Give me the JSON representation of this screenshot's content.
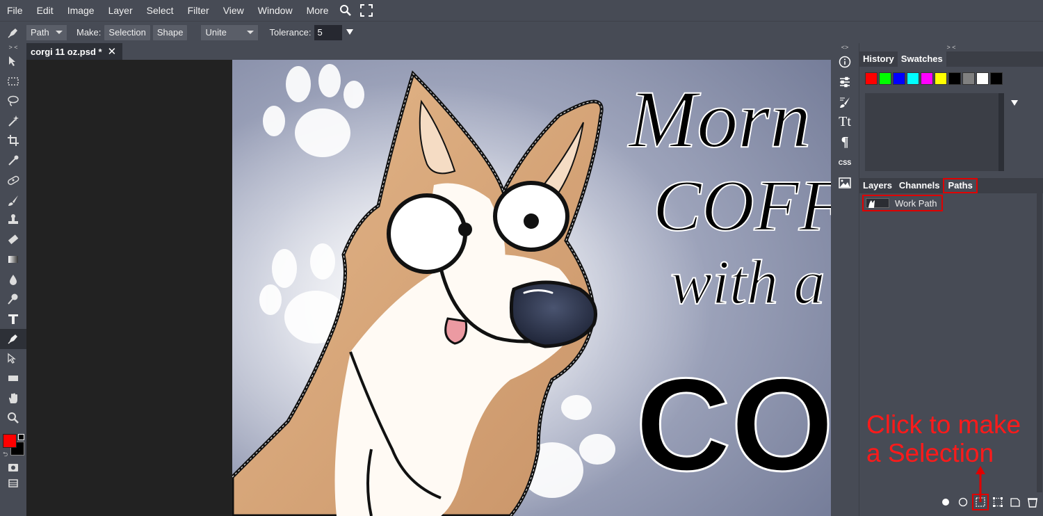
{
  "menu": {
    "items": [
      "File",
      "Edit",
      "Image",
      "Layer",
      "Select",
      "Filter",
      "View",
      "Window",
      "More"
    ],
    "icons": [
      "search-icon",
      "fullscreen-icon"
    ]
  },
  "options": {
    "tool_icon": "pen-icon",
    "mode_value": "Path",
    "make_label": "Make:",
    "selection_label": "Selection",
    "shape_label": "Shape",
    "combine_value": "Unite",
    "tolerance_label": "Tolerance:",
    "tolerance_value": "5"
  },
  "toolbar": {
    "collapse_label": "> <",
    "tools": [
      "move-tool-icon",
      "marquee-tool-icon",
      "lasso-tool-icon",
      "magic-wand-icon",
      "crop-tool-icon",
      "eyedropper-icon",
      "healing-brush-icon",
      "brush-tool-icon",
      "clone-stamp-icon",
      "eraser-icon",
      "gradient-icon",
      "blur-drop-icon",
      "dodge-icon",
      "type-tool-icon",
      "pen-tool-icon",
      "path-select-icon",
      "rectangle-tool-icon",
      "hand-tool-icon",
      "zoom-tool-icon"
    ],
    "active_tool": "pen-tool-icon",
    "foreground_color": "#ff0000",
    "background_color": "#000000"
  },
  "document": {
    "tab_title": "corgi 11 oz.psd *",
    "close_label": "✕"
  },
  "midcol": {
    "collapse_label": "<>",
    "icons": [
      "info-icon",
      "adjustments-icon",
      "brush-settings-icon",
      "character-icon",
      "paragraph-icon",
      "css-icon",
      "image-icon"
    ],
    "css_label": "CSS"
  },
  "rightpanel": {
    "collapse_label": "> <",
    "top_tabs": [
      "History",
      "Swatches"
    ],
    "swatches": [
      "#ff0000",
      "#00ff00",
      "#0000ff",
      "#00ffff",
      "#ff00ff",
      "#ffff00",
      "#000000",
      "#808080",
      "#ffffff",
      "#000000"
    ],
    "bottom_tabs": [
      "Layers",
      "Channels",
      "Paths"
    ],
    "active_bottom_tab": "Paths",
    "path_name": "Work Path",
    "footer_icons": [
      "fill-path-icon",
      "stroke-path-icon",
      "load-as-selection-icon",
      "make-work-path-icon",
      "new-path-icon",
      "delete-path-icon"
    ]
  },
  "artwork": {
    "text_line1": "Morn",
    "text_line2": "COFF",
    "text_line3": "with a",
    "text_line4": "COR"
  },
  "annotation": {
    "line1": "Click to make",
    "line2": "a Selection",
    "color": "#ff1a1a"
  }
}
